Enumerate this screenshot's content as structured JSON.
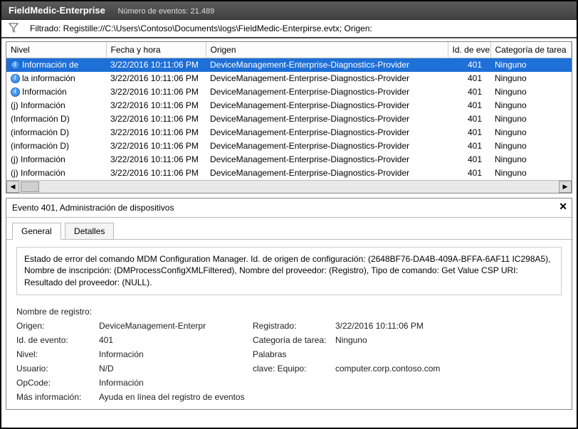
{
  "titlebar": {
    "app": "FieldMedic-Enterprise",
    "count_label": "Número de eventos: 21.489"
  },
  "filter": {
    "text": "Filtrado: Registille://C:\\Users\\Contoso\\Documents\\logs\\FieldMedic-Enterpirse.evtx; Origen:"
  },
  "grid": {
    "headers": {
      "level": "Nivel",
      "datetime": "Fecha y hora",
      "origin": "Origen",
      "event_id": "Id. de evento",
      "category": "Categoría de tarea"
    },
    "rows": [
      {
        "icon": "info",
        "level": "Información de",
        "datetime": "3/22/2016 10:11:06 PM",
        "origin": "DeviceManagement-Enterprise-Diagnostics-Provider",
        "event_id": "401",
        "category": "Ninguno",
        "selected": true
      },
      {
        "icon": "info",
        "level": "la información",
        "datetime": "3/22/2016 10:11:06 PM",
        "origin": "DeviceManagement-Enterprise-Diagnostics-Provider",
        "event_id": "401",
        "category": "Ninguno"
      },
      {
        "icon": "info",
        "level": "Información",
        "datetime": "3/22/2016 10:11:06 PM",
        "origin": "DeviceManagement-Enterprise-Diagnostics-Provider",
        "event_id": "401",
        "category": "Ninguno"
      },
      {
        "icon": "textj",
        "level": "(j) Información",
        "datetime": "3/22/2016 10:11:06 PM",
        "origin": "DeviceManagement-Enterprise-Diagnostics-Provider",
        "event_id": "401",
        "category": "Ninguno"
      },
      {
        "icon": "textD",
        "level": "(Información D)",
        "datetime": "3/22/2016 10:11:06 PM",
        "origin": "DeviceManagement-Enterprise-Diagnostics-Provider",
        "event_id": "401",
        "category": "Ninguno"
      },
      {
        "icon": "textD",
        "level": "(información D)",
        "datetime": "3/22/2016 10:11:06 PM",
        "origin": "DeviceManagement-Enterprise-Diagnostics-Provider",
        "event_id": "401",
        "category": "Ninguno"
      },
      {
        "icon": "textD",
        "level": "(información D)",
        "datetime": "3/22/2016 10:11:06 PM",
        "origin": "DeviceManagement-Enterprise-Diagnostics-Provider",
        "event_id": "401",
        "category": "Ninguno"
      },
      {
        "icon": "textj",
        "level": "(j) Información",
        "datetime": "3/22/2016 10:11:06 PM",
        "origin": "DeviceManagement-Enterprise-Diagnostics-Provider",
        "event_id": "401",
        "category": "Ninguno"
      },
      {
        "icon": "textj",
        "level": "(j) Información",
        "datetime": "3/22/2016 10:11:06 PM",
        "origin": "DeviceManagement-Enterprise-Diagnostics-Provider",
        "event_id": "401",
        "category": "Ninguno"
      }
    ]
  },
  "detail": {
    "header": "Evento 401, Administración de dispositivos",
    "tabs": {
      "general": "General",
      "details": "Detalles"
    },
    "desc_line1": "Estado de error del comando MDM Configuration Manager. Id. de origen de configuración: (2648BF76-DA4B-409A-BFFA-6AF11 IC298A5),",
    "desc_line2": "Nombre de inscripción: (DMProcessConfigXMLFiltered), Nombre del proveedor: (Registro), Tipo de comando: Get Value CSP URI:",
    "desc_line3": "Resultado del proveedor: (NULL).",
    "labels": {
      "log_name": "Nombre de registro:",
      "origin": "Origen:",
      "event_id": "Id. de evento:",
      "level": "Nivel:",
      "user": "Usuario:",
      "opcode": "OpCode:",
      "more_info": "Más información:",
      "registered": "Registrado:",
      "task_cat": "Categoría de tarea:",
      "keywords": "Palabras",
      "computer": "clave: Equipo:"
    },
    "values": {
      "log_name": "",
      "origin": "DeviceManagement-Enterpr",
      "event_id": "401",
      "level": "Información",
      "user": "N/D",
      "opcode": "Información",
      "more_info": "Ayuda en línea del registro de eventos",
      "registered": "3/22/2016 10:11:06 PM",
      "task_cat": "Ninguno",
      "keywords": "",
      "computer": "computer.corp.contoso.com"
    }
  }
}
